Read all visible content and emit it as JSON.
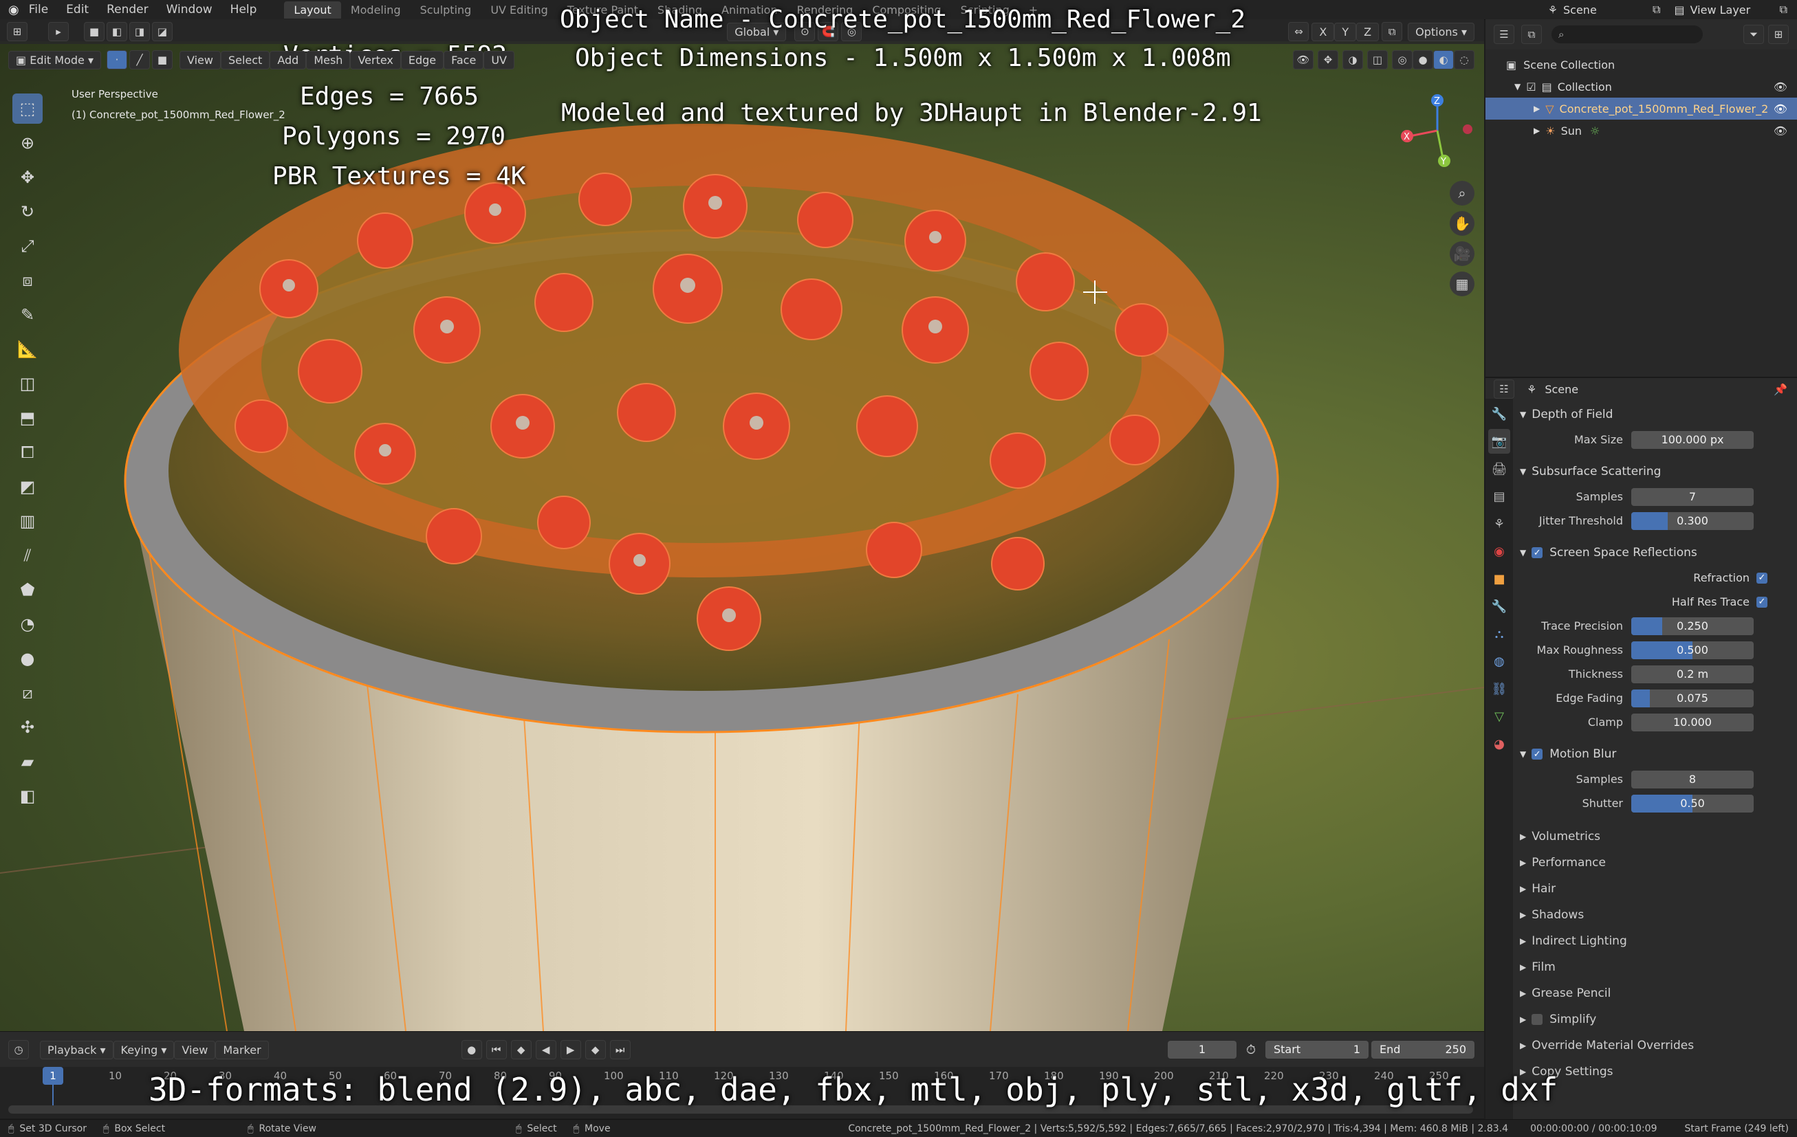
{
  "topbar": {
    "menus": [
      "File",
      "Edit",
      "Render",
      "Window",
      "Help"
    ],
    "workspaces": [
      "Layout",
      "Modeling",
      "Sculpting",
      "UV Editing",
      "Texture Paint",
      "Shading",
      "Animation",
      "Rendering",
      "Compositing",
      "Scripting"
    ],
    "add_workspace": "+",
    "scene_label": "Scene",
    "view_layer_label": "View Layer"
  },
  "viewport_header": {
    "mode": "Edit Mode",
    "menus": [
      "View",
      "Select",
      "Add",
      "Mesh",
      "Vertex",
      "Edge",
      "Face",
      "UV"
    ],
    "transform_orientation": "Global",
    "axes": [
      "X",
      "Y",
      "Z"
    ],
    "options_label": "Options"
  },
  "viewport": {
    "perspective_label": "User Perspective",
    "object_label": "(1) Concrete_pot_1500mm_Red_Flower_2",
    "overlay": {
      "object_name": "Object Name - Concrete_pot_1500mm_Red_Flower_2",
      "dimensions": "Object Dimensions -  1.500m x 1.500m x 1.008m",
      "credit": "Modeled and textured by 3DHaupt in Blender-2.91",
      "vertices": "Vertices = 5592",
      "edges": "Edges = 7665",
      "polygons": "Polygons = 2970",
      "pbr": "PBR Textures = 4K",
      "formats": "3D-formats: blend (2.9), abc, dae, fbx, mtl, obj, ply, stl, x3d, gltf, dxf"
    },
    "gizmo_axes": [
      "X",
      "Y",
      "Z"
    ]
  },
  "outliner": {
    "search_placeholder": "",
    "items": [
      {
        "label": "Scene Collection"
      },
      {
        "label": "Collection"
      },
      {
        "label": "Concrete_pot_1500mm_Red_Flower_2"
      },
      {
        "label": "Sun"
      }
    ]
  },
  "properties": {
    "header_label": "Scene",
    "depth_of_field": {
      "title": "Depth of Field",
      "max_size_label": "Max Size",
      "max_size": "100.000 px"
    },
    "subsurface": {
      "title": "Subsurface Scattering",
      "samples_label": "Samples",
      "samples": "7",
      "jitter_label": "Jitter Threshold",
      "jitter": "0.300",
      "jitter_fraction": 0.3
    },
    "ssr": {
      "title": "Screen Space Reflections",
      "refraction_label": "Refraction",
      "half_res_label": "Half Res Trace",
      "trace_precision_label": "Trace Precision",
      "trace_precision": "0.250",
      "trace_precision_fraction": 0.25,
      "max_roughness_label": "Max Roughness",
      "max_roughness": "0.500",
      "max_roughness_fraction": 0.5,
      "thickness_label": "Thickness",
      "thickness": "0.2 m",
      "edge_fading_label": "Edge Fading",
      "edge_fading": "0.075",
      "edge_fading_fraction": 0.15,
      "clamp_label": "Clamp",
      "clamp": "10.000"
    },
    "motion_blur": {
      "title": "Motion Blur",
      "samples_label": "Samples",
      "samples": "8",
      "shutter_label": "Shutter",
      "shutter": "0.50",
      "shutter_fraction": 0.5
    },
    "collapsed_panels": [
      "Volumetrics",
      "Performance",
      "Hair",
      "Shadows",
      "Indirect Lighting",
      "Film",
      "Grease Pencil",
      "Simplify",
      "Override Material Overrides",
      "Copy Settings"
    ]
  },
  "timeline": {
    "menus": [
      "Playback",
      "Keying",
      "View",
      "Marker"
    ],
    "current_frame": "1",
    "start_label": "Start",
    "start": "1",
    "end_label": "End",
    "end": "250",
    "ticks": [
      "1",
      "10",
      "20",
      "30",
      "40",
      "50",
      "60",
      "70",
      "80",
      "90",
      "100",
      "110",
      "120",
      "130",
      "140",
      "150",
      "160",
      "170",
      "180",
      "190",
      "200",
      "210",
      "220",
      "230",
      "240",
      "250"
    ]
  },
  "statusbar": {
    "left_items": [
      "Set 3D Cursor",
      "Box Select",
      "Rotate View",
      "Select",
      "Move"
    ],
    "info": "Concrete_pot_1500mm_Red_Flower_2 | Verts:5,592/5,592 | Edges:7,665/7,665 | Faces:2,970/2,970 | Tris:4,394 | Mem: 460.8 MiB | 2.83.4",
    "time": "00:00:00:00 / 00:00:10:09",
    "start_frame": "Start Frame (249 left)"
  },
  "colors": {
    "accent": "#4772b3",
    "selected": "#4f6fa7",
    "edge_orange": "#ff8a1e",
    "flower_red": "#e2452a"
  }
}
